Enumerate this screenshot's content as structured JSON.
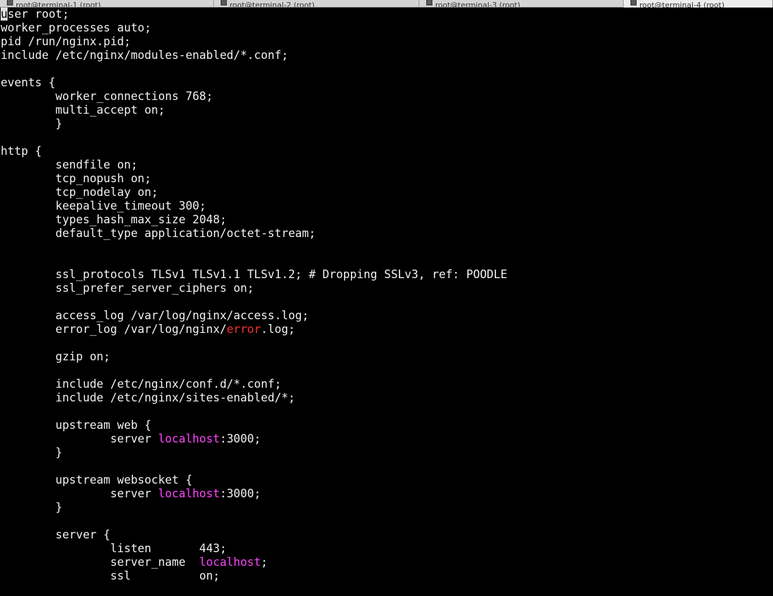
{
  "tabs": [
    {
      "label": "root@terminal-1 (root)",
      "active": false
    },
    {
      "label": "root@terminal-2 (root)",
      "active": false
    },
    {
      "label": "root@terminal-3 (root)",
      "active": false
    },
    {
      "label": "root@terminal-4 (root)",
      "active": true
    }
  ],
  "editor": {
    "cursor": {
      "line": 0,
      "char": 0
    },
    "colors": {
      "background": "#000000",
      "text": "#f2f2f2",
      "keyword_highlight": "#ff44ff",
      "error_highlight": "#ff3030",
      "cursor": "#e0e0e0"
    },
    "lines": [
      [
        {
          "t": "user root;"
        }
      ],
      [
        {
          "t": "worker_processes auto;"
        }
      ],
      [
        {
          "t": "pid /run/nginx.pid;"
        }
      ],
      [
        {
          "t": "include /etc/nginx/modules-enabled/*.conf;"
        }
      ],
      [],
      [
        {
          "t": "events {"
        }
      ],
      [
        {
          "t": "        worker_connections 768;"
        }
      ],
      [
        {
          "t": "        multi_accept on;"
        }
      ],
      [
        {
          "t": "        }"
        }
      ],
      [],
      [
        {
          "t": "http {"
        }
      ],
      [
        {
          "t": "        sendfile on;"
        }
      ],
      [
        {
          "t": "        tcp_nopush on;"
        }
      ],
      [
        {
          "t": "        tcp_nodelay on;"
        }
      ],
      [
        {
          "t": "        keepalive_timeout 300;"
        }
      ],
      [
        {
          "t": "        types_hash_max_size 2048;"
        }
      ],
      [
        {
          "t": "        default_type application/octet-stream;"
        }
      ],
      [],
      [],
      [
        {
          "t": "        ssl_protocols TLSv1 TLSv1.1 TLSv1.2; # Dropping SSLv3, ref: POODLE"
        }
      ],
      [
        {
          "t": "        ssl_prefer_server_ciphers on;"
        }
      ],
      [],
      [
        {
          "t": "        access_log /var/log/nginx/access.log;"
        }
      ],
      [
        {
          "t": "        error_log /var/log/nginx/"
        },
        {
          "t": "error",
          "c": "err"
        },
        {
          "t": ".log;"
        }
      ],
      [],
      [
        {
          "t": "        gzip on;"
        }
      ],
      [],
      [
        {
          "t": "        include /etc/nginx/conf.d/*.conf;"
        }
      ],
      [
        {
          "t": "        include /etc/nginx/sites-enabled/*;"
        }
      ],
      [],
      [
        {
          "t": "        upstream web {"
        }
      ],
      [
        {
          "t": "                server "
        },
        {
          "t": "localhost",
          "c": "hl"
        },
        {
          "t": ":3000;"
        }
      ],
      [
        {
          "t": "        }"
        }
      ],
      [],
      [
        {
          "t": "        upstream websocket {"
        }
      ],
      [
        {
          "t": "                server "
        },
        {
          "t": "localhost",
          "c": "hl"
        },
        {
          "t": ":3000;"
        }
      ],
      [
        {
          "t": "        }"
        }
      ],
      [],
      [
        {
          "t": "        server {"
        }
      ],
      [
        {
          "t": "                listen       443;"
        }
      ],
      [
        {
          "t": "                server_name  "
        },
        {
          "t": "localhost",
          "c": "hl"
        },
        {
          "t": ";"
        }
      ],
      [
        {
          "t": "                ssl          on;"
        }
      ]
    ]
  }
}
